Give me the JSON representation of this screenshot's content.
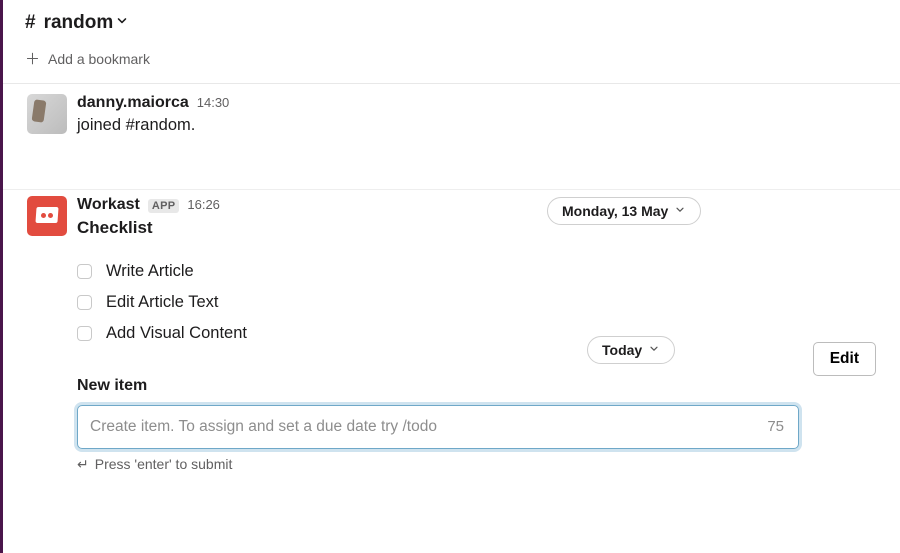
{
  "header": {
    "channel_name": "random",
    "hash": "#",
    "add_bookmark_label": "Add a bookmark"
  },
  "date_pills": {
    "first": "Monday, 13 May",
    "second": "Today"
  },
  "messages": {
    "join": {
      "sender": "danny.maiorca",
      "time": "14:30",
      "text": "joined #random."
    },
    "workast": {
      "sender": "Workast",
      "badge": "APP",
      "time": "16:26",
      "block_title": "Checklist",
      "edit_label": "Edit",
      "items": [
        "Write Article",
        "Edit Article Text",
        "Add Visual Content"
      ],
      "new_item_label": "New item",
      "input_placeholder": "Create item. To assign and set a due date try /todo",
      "char_remaining": "75",
      "hint": "Press 'enter' to submit"
    }
  }
}
